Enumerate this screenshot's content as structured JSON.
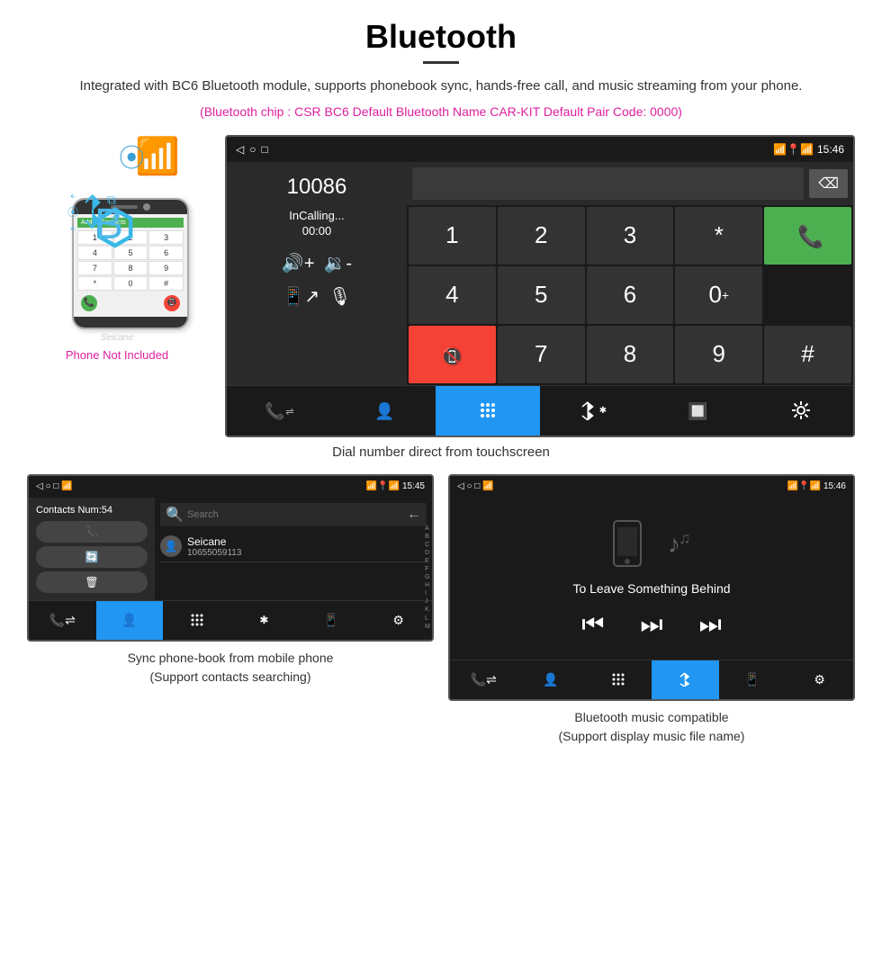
{
  "header": {
    "title": "Bluetooth",
    "description": "Integrated with BC6 Bluetooth module, supports phonebook sync, hands-free call, and music streaming from your phone.",
    "specs": "(Bluetooth chip : CSR BC6    Default Bluetooth Name CAR-KIT    Default Pair Code: 0000)"
  },
  "main_screen": {
    "status_bar": {
      "time": "15:46",
      "left_icons": [
        "◁",
        "○",
        "□"
      ]
    },
    "number_display": "10086",
    "calling_status": "InCalling...",
    "timer": "00:00",
    "keypad": {
      "keys": [
        "1",
        "2",
        "3",
        "*",
        "4",
        "5",
        "6",
        "0+",
        "7",
        "8",
        "9",
        "#"
      ],
      "call_key": "📞",
      "end_key": "📞"
    },
    "bottom_tabs": [
      "📞",
      "👤",
      "⠿",
      "✱",
      "🔲",
      "⚙"
    ]
  },
  "phone_mockup": {
    "add_to_contacts": "Add to Contacts",
    "keys": [
      "1",
      "2",
      "3",
      "4",
      "5",
      "6",
      "7",
      "8",
      "9",
      "*",
      "0",
      "#"
    ],
    "watermark": "Seicane"
  },
  "labels": {
    "phone_not_included": "Phone Not Included",
    "main_caption": "Dial number direct from touchscreen",
    "contacts_caption_line1": "Sync phone-book from mobile phone",
    "contacts_caption_line2": "(Support contacts searching)",
    "music_caption_line1": "Bluetooth music compatible",
    "music_caption_line2": "(Support display music file name)"
  },
  "contacts_screen": {
    "status_bar_time": "15:45",
    "contacts_count": "Contacts Num:54",
    "contact_name": "Seicane",
    "contact_number": "10655059113",
    "search_placeholder": "Search",
    "alpha_list": [
      "A",
      "B",
      "C",
      "D",
      "E",
      "F",
      "G",
      "H",
      "I",
      "J",
      "K",
      "L",
      "M"
    ],
    "action_icons": [
      "📞",
      "🔄",
      "🗑"
    ],
    "bottom_tabs_active_index": 1
  },
  "music_screen": {
    "status_bar_time": "15:46",
    "track_name": "To Leave Something Behind",
    "controls": [
      "⏮",
      "⏭",
      "⏭"
    ],
    "bottom_tabs_active_index": 3
  }
}
